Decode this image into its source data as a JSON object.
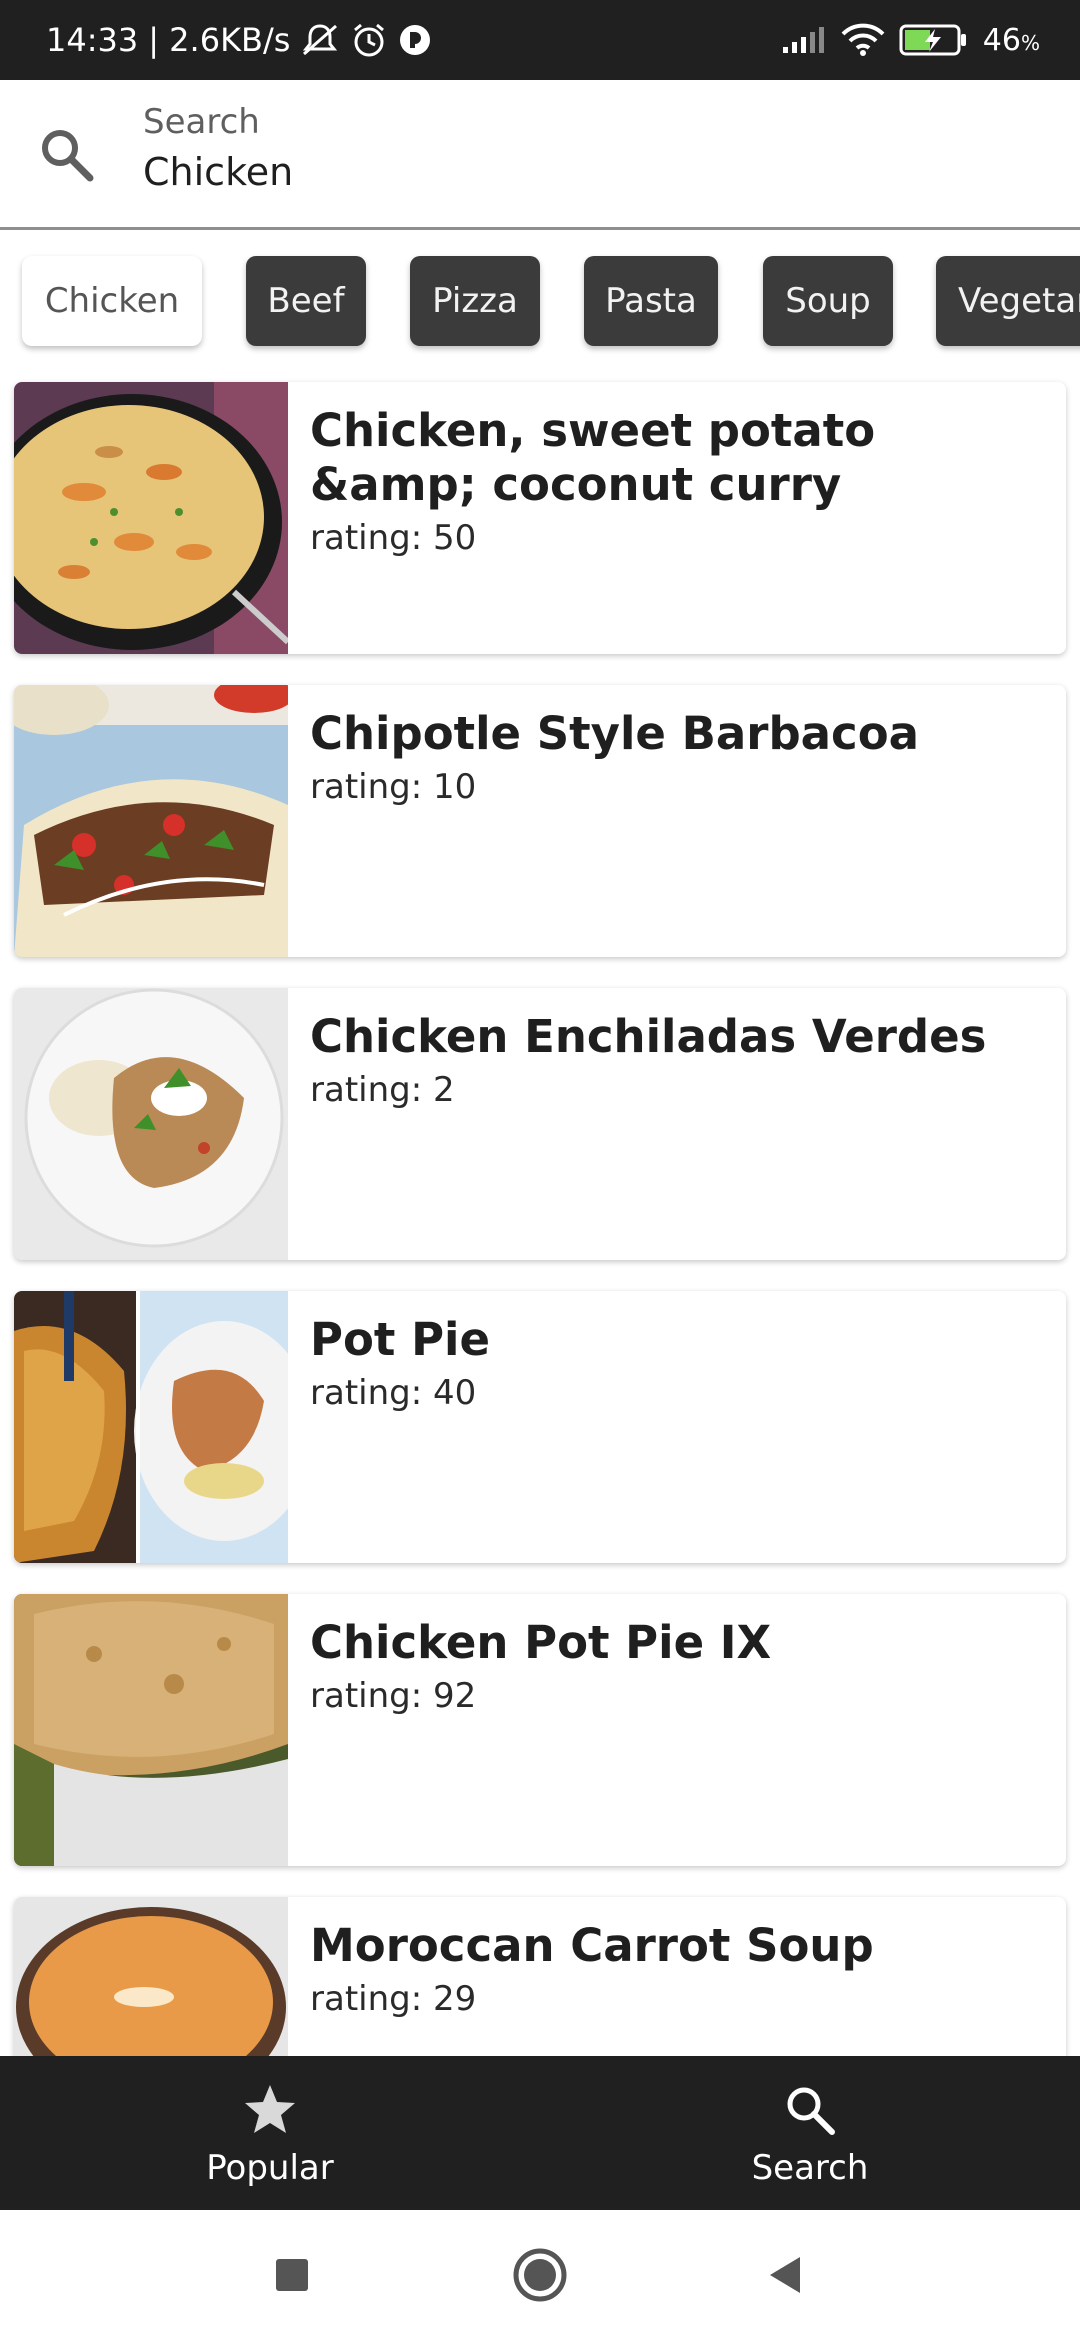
{
  "status_bar": {
    "time": "14:33",
    "speed": "| 2.6KB/s",
    "battery_pct": "46",
    "battery_unit": "%",
    "icons": [
      "mute-icon",
      "alarm-icon",
      "app-notification-icon",
      "signal-icon",
      "wifi-icon",
      "battery-charging-icon"
    ]
  },
  "search": {
    "label": "Search",
    "value": "Chicken",
    "icon": "search-icon"
  },
  "categories": [
    {
      "label": "Chicken",
      "selected": true
    },
    {
      "label": "Beef",
      "selected": false
    },
    {
      "label": "Pizza",
      "selected": false
    },
    {
      "label": "Pasta",
      "selected": false
    },
    {
      "label": "Soup",
      "selected": false
    },
    {
      "label": "Vegetar",
      "selected": false
    }
  ],
  "recipes": [
    {
      "title": "Chicken, sweet potato &amp; coconut curry",
      "rating": "rating: 50",
      "image": "curry-in-skillet"
    },
    {
      "title": "Chipotle Style Barbacoa",
      "rating": "rating: 10",
      "image": "tacos"
    },
    {
      "title": "Chicken Enchiladas Verdes",
      "rating": "rating: 2",
      "image": "enchilada-plate"
    },
    {
      "title": "Pot Pie",
      "rating": "rating: 40",
      "image": "pot-pie-slices"
    },
    {
      "title": "Chicken Pot Pie IX",
      "rating": "rating: 92",
      "image": "pot-pie-crust"
    },
    {
      "title": "Moroccan Carrot Soup",
      "rating": "rating: 29",
      "image": "carrot-soup-bowl"
    }
  ],
  "bottom_nav": [
    {
      "label": "Popular",
      "icon": "star-icon"
    },
    {
      "label": "Search",
      "icon": "search-icon"
    }
  ],
  "system_nav": [
    "recents-icon",
    "home-icon",
    "back-icon"
  ],
  "colors": {
    "bar_dark": "#202020",
    "chip_dark": "#3b3b3b",
    "background": "#ffffff"
  }
}
